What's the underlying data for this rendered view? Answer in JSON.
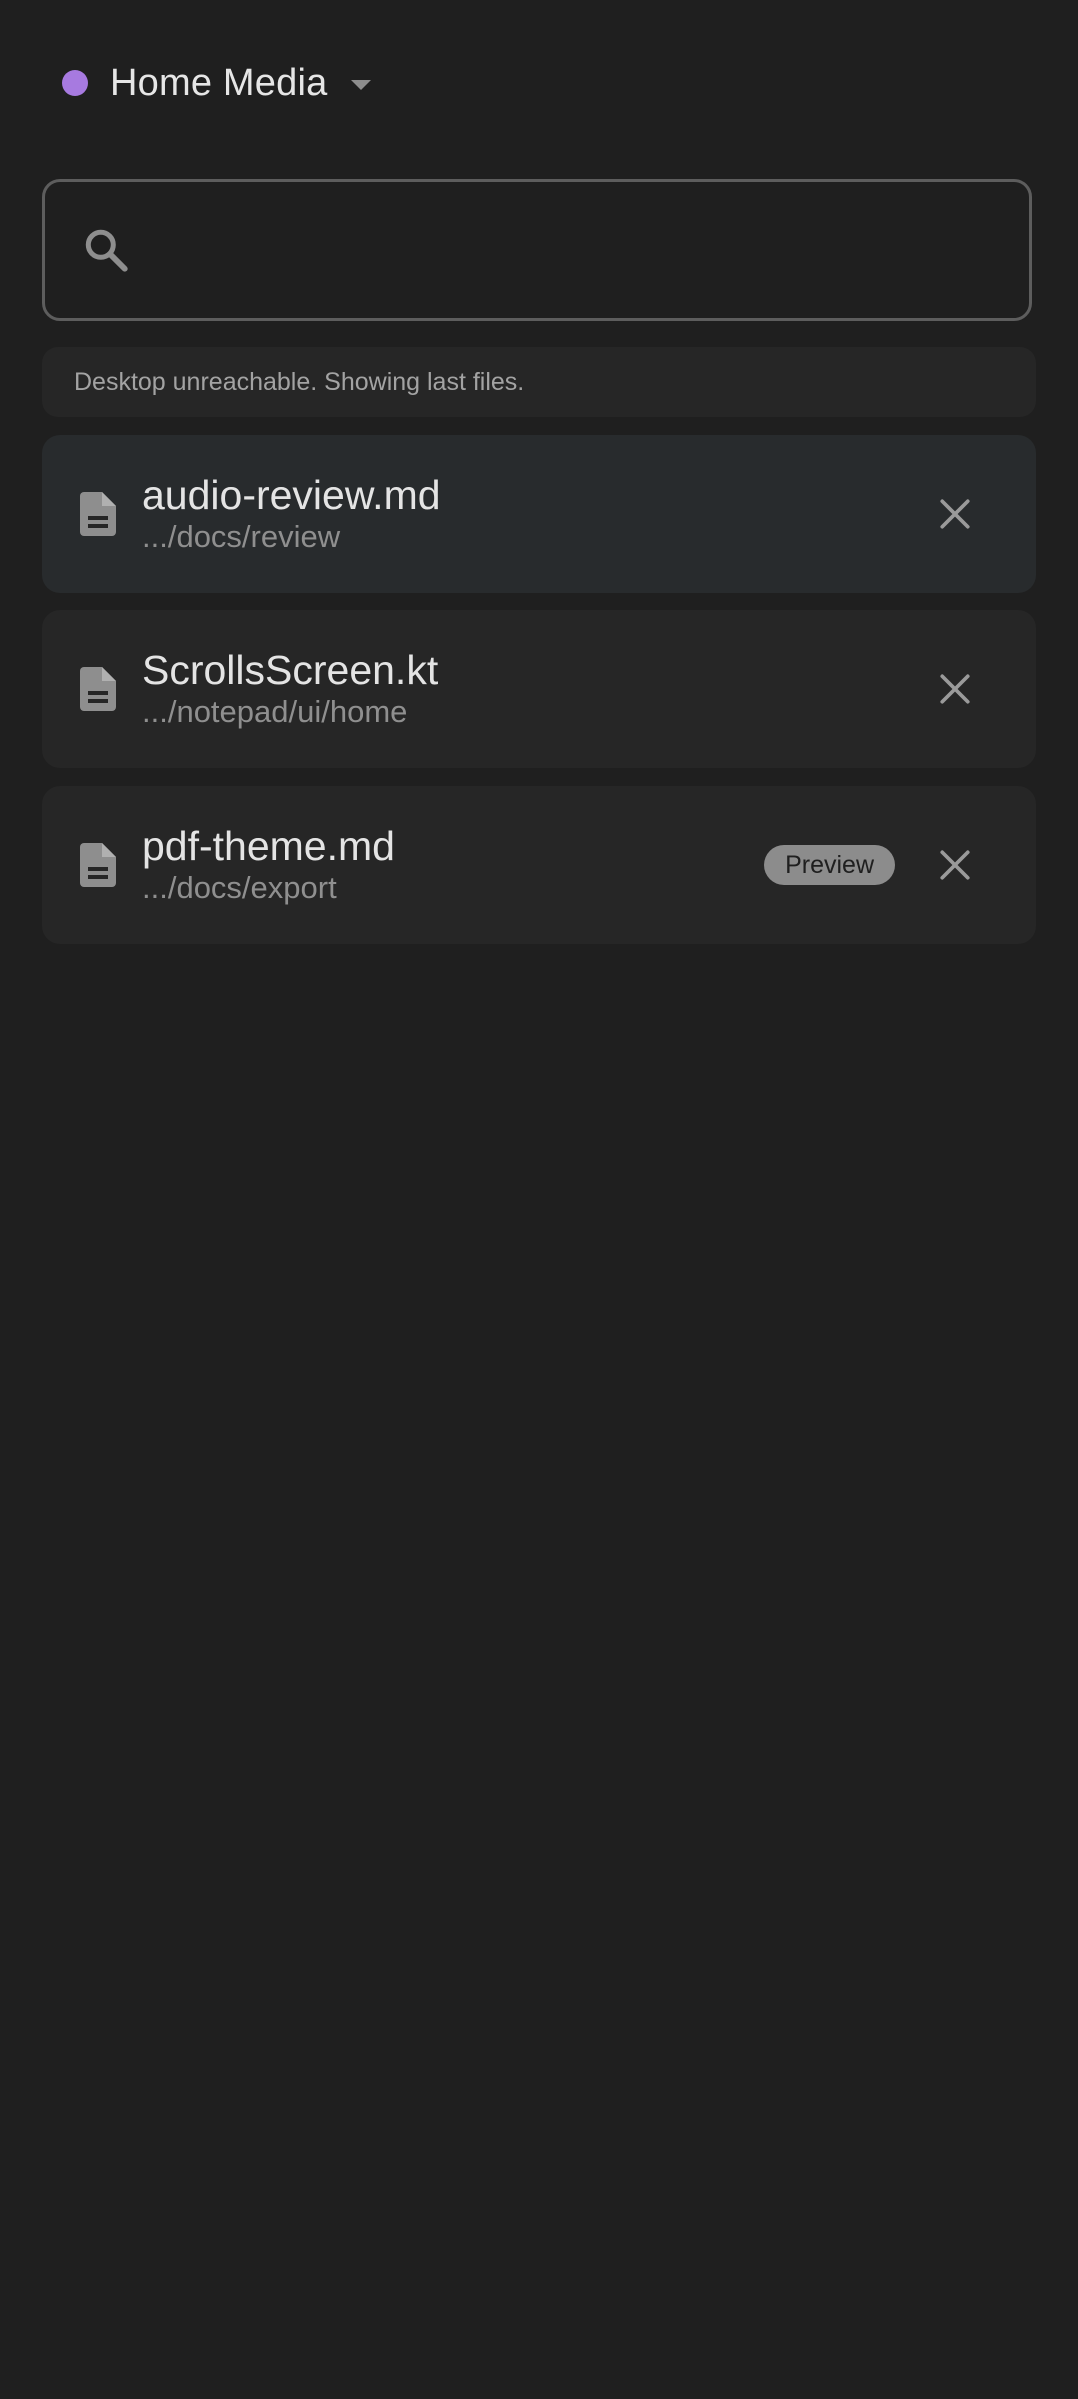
{
  "header": {
    "device_name": "Home Media",
    "status_color": "#a77ae0"
  },
  "search": {
    "value": "",
    "placeholder": ""
  },
  "banner": {
    "text": "Desktop unreachable. Showing last files."
  },
  "files": [
    {
      "name": "audio-review.md",
      "path": ".../docs/review",
      "badge": "",
      "icon": "document-icon"
    },
    {
      "name": "ScrollsScreen.kt",
      "path": ".../notepad/ui/home",
      "badge": "",
      "icon": "document-icon"
    },
    {
      "name": "pdf-theme.md",
      "path": ".../docs/export",
      "badge": "Preview",
      "icon": "document-icon"
    }
  ],
  "colors": {
    "background": "#1f1f1f",
    "card": "#262626",
    "card_selected": "#282b2d",
    "accent": "#a77ae0"
  }
}
